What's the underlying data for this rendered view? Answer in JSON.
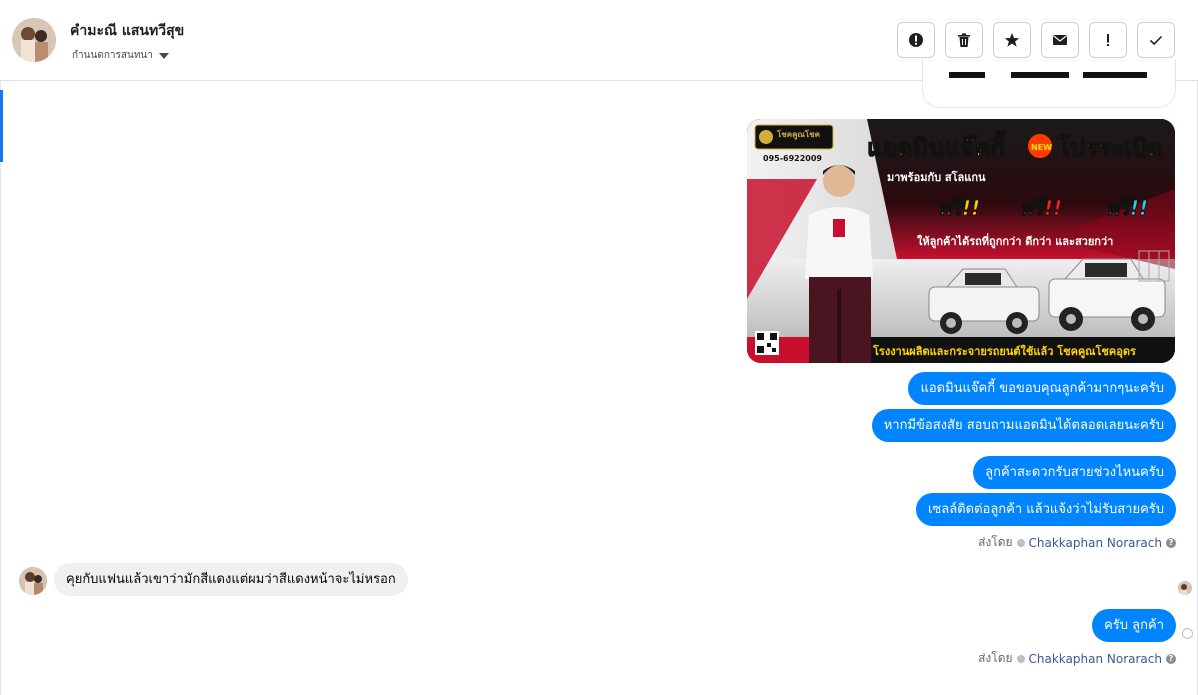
{
  "header": {
    "contact_name": "คำมะณี แสนทวีสุข",
    "conversation_label": "กำนนดการสนทนา"
  },
  "actions": [
    {
      "name": "mark-spam",
      "icon": "alert-circle-icon"
    },
    {
      "name": "delete",
      "icon": "trash-icon"
    },
    {
      "name": "star",
      "icon": "star-icon"
    },
    {
      "name": "mark-unread",
      "icon": "envelope-icon"
    },
    {
      "name": "follow-up",
      "icon": "exclamation-icon"
    },
    {
      "name": "mark-done",
      "icon": "checkmark-icon"
    }
  ],
  "ad_image": {
    "brand": "โชคคูณโชค",
    "phone": "095-6922009",
    "headline": "แอดมินแจ๊คกี้",
    "headline_badge": "NEW",
    "headline_right": "โปรระเบิด",
    "subline": "มาพร้อมกับ สโลแกน",
    "free_1": "ฟรี!!",
    "free_2": "ฟรี!!",
    "free_3": "ฟรี!!",
    "tagline": "ให้ลูกค้าได้รถที่ถูกกว่า ดีกว่า และสวยกว่า",
    "footer": "โรงงานผลิตและกระจายรถยนต์ใช้แล้ว โชคคูณโชคอุดร"
  },
  "messages": {
    "out_1": "แอดมินแจ๊คกี้ ขอขอบคุณลูกค้ามากๆนะครับ",
    "out_2": "หากมีข้อสงสัย สอบถามแอดมินได้ตลอดเลยนะครับ",
    "out_3": "ลูกค้าสะดวกรับสายช่วงไหนครับ",
    "out_4": "เซลล์ติดต่อลูกค้า แล้วแจ้งว่าไม่รับสายครับ",
    "in_1": "คุยกับแฟนแล้วเขาว่ามักสีแดงแต่ผมว่าสีแดงหน้าจะไม่หรอก",
    "out_5": "ครับ ลูกค้า"
  },
  "sent_by": {
    "label": "ส่งโดย",
    "agent": "Chakkaphan Norarach",
    "help": "?"
  },
  "colors": {
    "accent": "#1877f2",
    "outgoing_bubble": "#0084ff",
    "incoming_bubble": "#f0f0f0",
    "ad_red": "#c8102e"
  }
}
